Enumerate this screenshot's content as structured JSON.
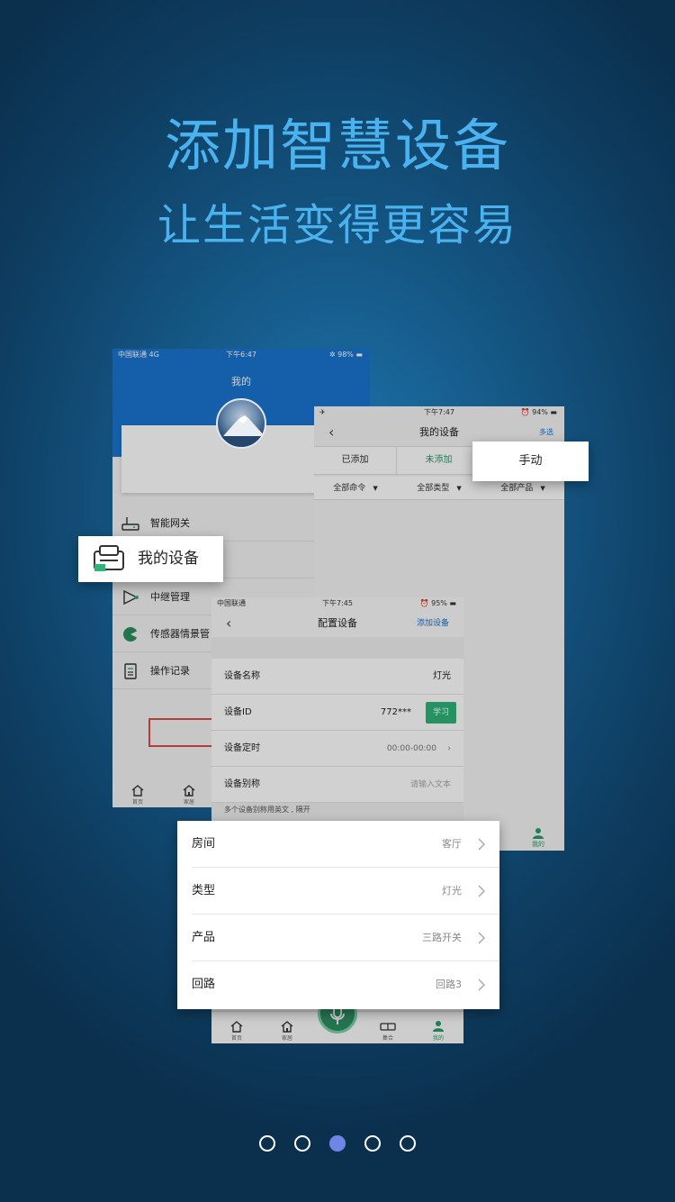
{
  "headline": {
    "title": "添加智慧设备",
    "subtitle": "让生活变得更容易"
  },
  "colors": {
    "accent_text": "#4ab2ef",
    "header_blue": "#1a74d0",
    "green": "#2fb37a",
    "dot_active": "#6f86e8"
  },
  "card_me": {
    "status": {
      "carrier": "中国联通  4G",
      "time": "下午6:47",
      "battery": "98%"
    },
    "title": "我的",
    "menu": [
      {
        "label": "智能网关",
        "icon": "router-icon"
      },
      {
        "label": "中继管理",
        "icon": "relay-icon"
      },
      {
        "label": "传感器情景管",
        "icon": "sensor-icon"
      },
      {
        "label": "操作记录",
        "icon": "log-icon"
      }
    ],
    "tabs": [
      {
        "label": "首页",
        "icon": "home-icon"
      },
      {
        "label": "家居",
        "icon": "house-icon"
      }
    ]
  },
  "card_devices": {
    "status": {
      "time": "下午7:47",
      "battery": "94%"
    },
    "title": "我的设备",
    "multi_select": "多选",
    "segments": [
      "已添加",
      "未添加"
    ],
    "filters": [
      "全部命令",
      "全部类型",
      "全部产品"
    ],
    "tab_me": "我的"
  },
  "card_config": {
    "status": {
      "carrier": "中国联通",
      "time": "下午7:45",
      "battery": "95%"
    },
    "title": "配置设备",
    "add_device": "添加设备",
    "rows": {
      "name_label": "设备名称",
      "name_value": "灯光",
      "id_label": "设备ID",
      "id_value": "772***",
      "learn": "学习",
      "timer_label": "设备定时",
      "timer_value": "00:00-00:00",
      "alias_label": "设备别称",
      "alias_placeholder": "请输入文本"
    },
    "hint": "多个设备别称用英文 , 隔开",
    "tabs": [
      "首页",
      "家居",
      "集合",
      "我的"
    ]
  },
  "popup_mydevice": {
    "label": "我的设备"
  },
  "popup_manual": {
    "label": "手动"
  },
  "popup_list": [
    {
      "label": "房间",
      "value": "客厅"
    },
    {
      "label": "类型",
      "value": "灯光"
    },
    {
      "label": "产品",
      "value": "三路开关"
    },
    {
      "label": "回路",
      "value": "回路3"
    }
  ],
  "pager": {
    "total": 5,
    "active": 3
  }
}
